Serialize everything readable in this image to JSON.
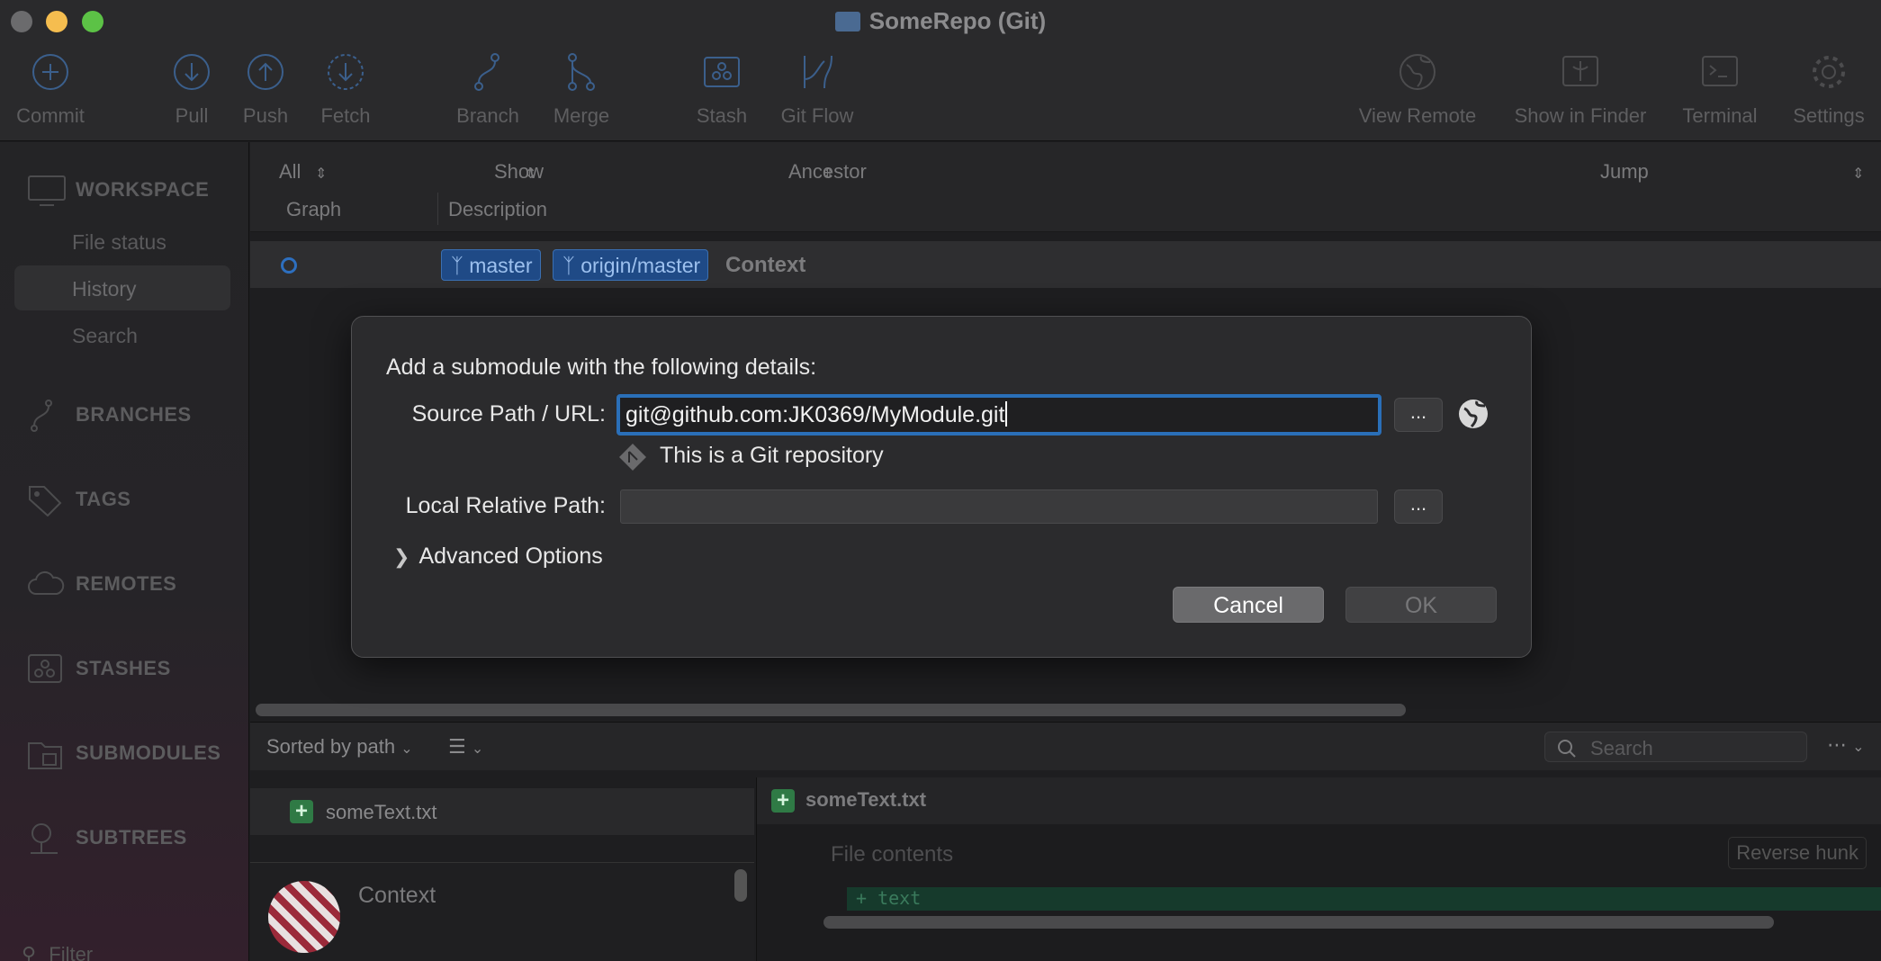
{
  "window": {
    "title": "SomeRepo (Git)"
  },
  "toolbar": {
    "commit": "Commit",
    "pull": "Pull",
    "push": "Push",
    "fetch": "Fetch",
    "branch": "Branch",
    "merge": "Merge",
    "stash": "Stash",
    "git_flow": "Git Flow",
    "view_remote": "View Remote",
    "show_in_finder": "Show in Finder",
    "terminal": "Terminal",
    "settings": "Settings"
  },
  "sidebar": {
    "workspace": "WORKSPACE",
    "file_status": "File status",
    "history": "History",
    "search": "Search",
    "branches": "BRANCHES",
    "tags": "TAGS",
    "remotes": "REMOTES",
    "stashes": "STASHES",
    "submodules": "SUBMODULES",
    "subtrees": "SUBTREES",
    "filter_placeholder": "Filter"
  },
  "filters": {
    "branches": "All Branches",
    "remote": "Show Remote Branches",
    "order": "Ancestor Order",
    "jump_to": "Jump to:"
  },
  "columns": {
    "graph": "Graph",
    "description": "Description"
  },
  "commit": {
    "tag_local": "master",
    "tag_remote": "origin/master",
    "message": "Context"
  },
  "bottom": {
    "sorted": "Sorted by path",
    "search_placeholder": "Search",
    "file": "someText.txt",
    "commit_title": "Context",
    "file_contents": "File contents",
    "reverse_hunk": "Reverse hunk",
    "diff_line": "+ text"
  },
  "dialog": {
    "heading": "Add a submodule with the following details:",
    "source_label": "Source Path / URL:",
    "source_value": "git@github.com:JK0369/MyModule.git",
    "browse": "...",
    "git_note": "This is a Git repository",
    "local_label": "Local Relative Path:",
    "local_value": "",
    "advanced": "Advanced Options",
    "cancel": "Cancel",
    "ok": "OK"
  },
  "colors": {
    "accent": "#2a6fb8",
    "branch_tag": "#1f4a86",
    "added": "#2f7a45"
  }
}
